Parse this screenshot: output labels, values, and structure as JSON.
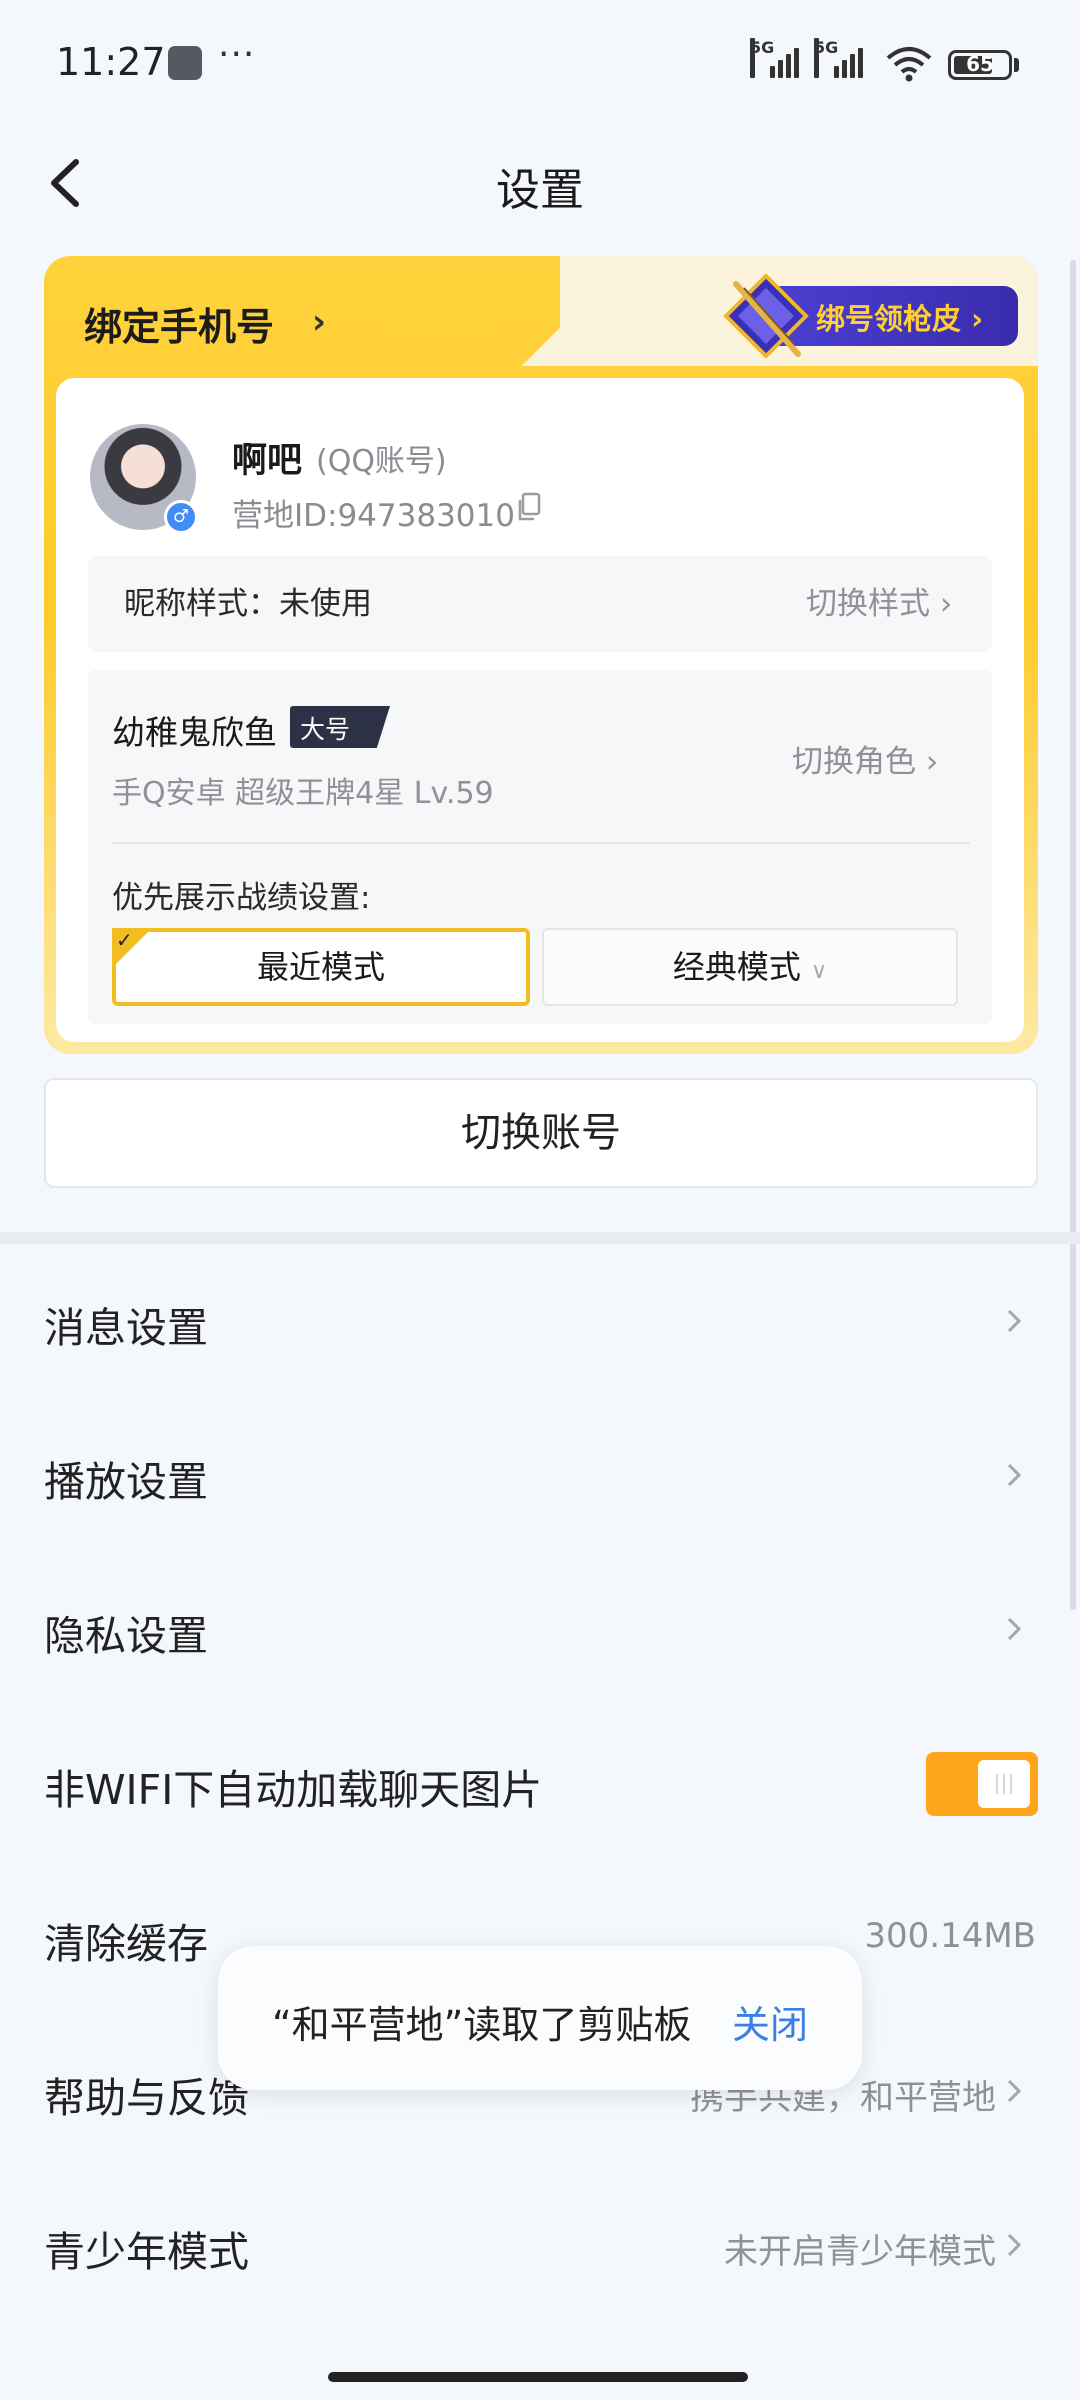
{
  "status_bar": {
    "time": "11:27",
    "more": "···",
    "network_1": "5G",
    "network_2": "5G",
    "battery": "65"
  },
  "header": {
    "title": "设置"
  },
  "account_card": {
    "bind_phone": "绑定手机号",
    "promo": "绑号领枪皮",
    "name": "啊吧",
    "account_type": "(QQ账号)",
    "camp_id": "营地ID:947383010",
    "nickname_style": "昵称样式：未使用",
    "switch_style": "切换样式",
    "role_name": "幼稚鬼欣鱼",
    "role_badge": "大号",
    "role_meta": "手Q安卓  超级王牌4星  Lv.59",
    "switch_role": "切换角色",
    "priority_label": "优先展示战绩设置:",
    "mode_recent": "最近模式",
    "mode_classic": "经典模式",
    "accent_color": "#f1bd21"
  },
  "switch_account": "切换账号",
  "settings": {
    "message": "消息设置",
    "playback": "播放设置",
    "privacy": "隐私设置",
    "auto_load": "非WIFI下自动加载聊天图片",
    "auto_load_on": true,
    "clear_cache": "清除缓存",
    "cache_size": "300.14MB",
    "help": "帮助与反馈",
    "help_value": "携手共建，和平营地",
    "youth": "青少年模式",
    "youth_value": "未开启青少年模式"
  },
  "toast": {
    "text": "“和平营地”读取了剪贴板",
    "close": "关闭"
  }
}
